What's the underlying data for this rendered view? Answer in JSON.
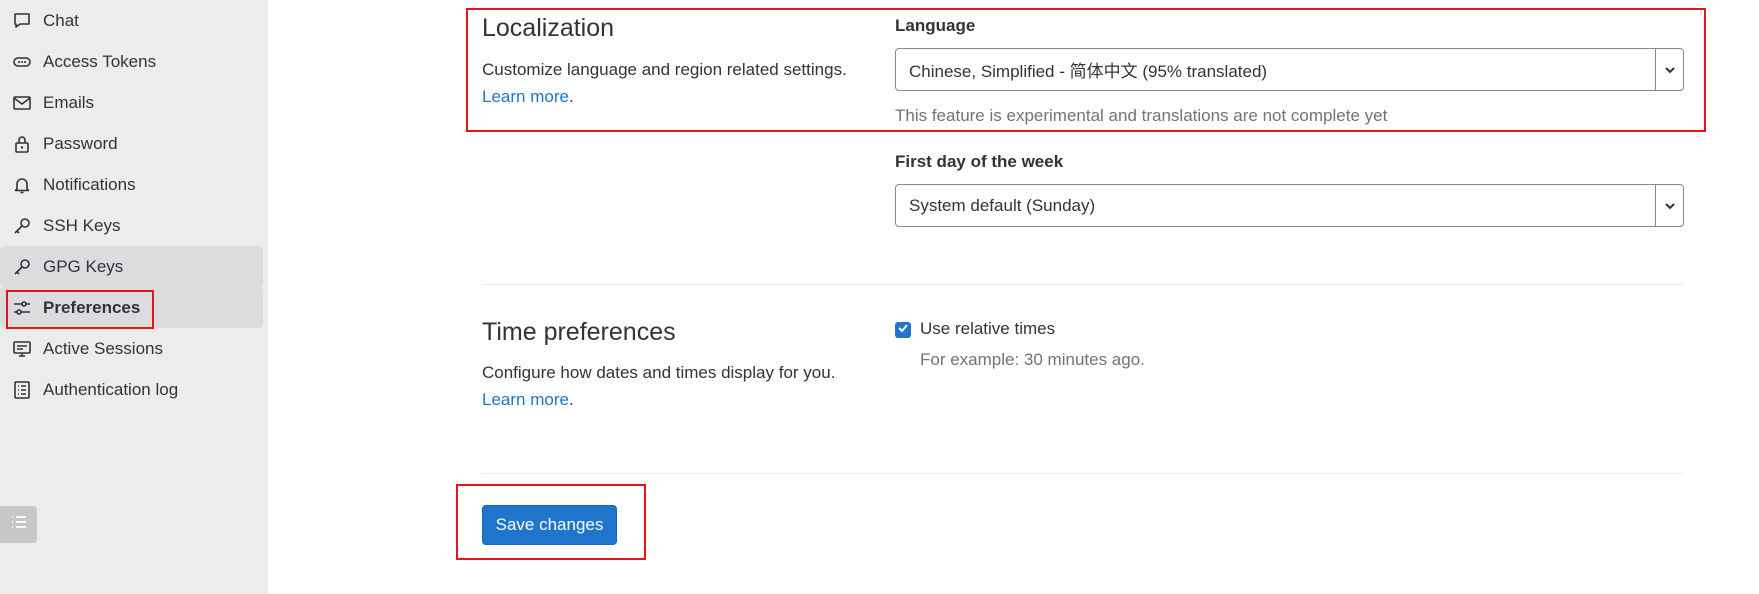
{
  "sidebar": {
    "items": [
      {
        "label": "Chat",
        "icon": "chat-icon"
      },
      {
        "label": "Access Tokens",
        "icon": "token-icon"
      },
      {
        "label": "Emails",
        "icon": "mail-icon"
      },
      {
        "label": "Password",
        "icon": "lock-icon"
      },
      {
        "label": "Notifications",
        "icon": "bell-icon"
      },
      {
        "label": "SSH Keys",
        "icon": "key-icon"
      },
      {
        "label": "GPG Keys",
        "icon": "key-icon"
      },
      {
        "label": "Preferences",
        "icon": "preferences-icon"
      },
      {
        "label": "Active Sessions",
        "icon": "monitor-icon"
      },
      {
        "label": "Authentication log",
        "icon": "log-icon"
      }
    ],
    "active": "Preferences",
    "hovered": "GPG Keys",
    "collapse_icon": "list-icon"
  },
  "localization": {
    "title": "Localization",
    "description": "Customize language and region related settings.",
    "learn_more": "Learn more",
    "period": ".",
    "language_label": "Language",
    "language_value": "Chinese, Simplified - 简体中文 (95% translated)",
    "language_help": "This feature is experimental and translations are not complete yet",
    "first_day_label": "First day of the week",
    "first_day_value": "System default (Sunday)"
  },
  "time_preferences": {
    "title": "Time preferences",
    "description": "Configure how dates and times display for you.",
    "learn_more": "Learn more",
    "period": ".",
    "relative_times_label": "Use relative times",
    "relative_times_checked": true,
    "example": "For example: 30 minutes ago."
  },
  "actions": {
    "save_label": "Save changes"
  },
  "colors": {
    "accent": "#1f75cb",
    "sidebar_bg": "#ececec",
    "annotation": "#e4141b"
  }
}
